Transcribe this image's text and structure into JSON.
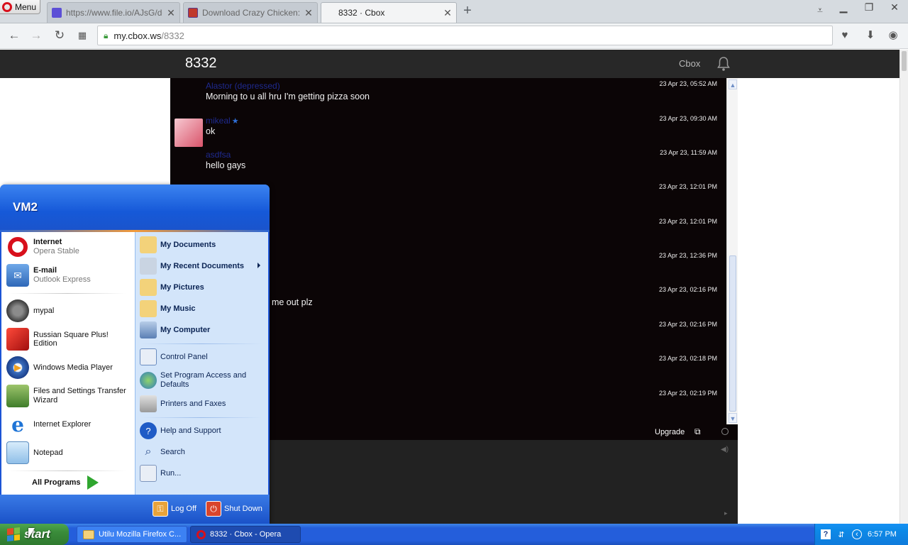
{
  "browser": {
    "menu_label": "Menu",
    "tabs": [
      {
        "title": "https://www.file.io/AJsG/do",
        "favicon_color": "#5c4fd6"
      },
      {
        "title": "Download Crazy Chicken: Th",
        "favicon_color": "#c0392b"
      },
      {
        "title": "8332 · Cbox",
        "favicon_color": "#ffffff"
      }
    ],
    "url_domain": "my.cbox.ws",
    "url_path": "/8332"
  },
  "page": {
    "title": "8332",
    "nav_label": "Cbox"
  },
  "chat": {
    "messages": [
      {
        "user": "Alastor (depressed)",
        "text": "Morning to u all hru I'm getting pizza soon",
        "time": "23 Apr 23, 05:52 AM"
      },
      {
        "user": "mikeal",
        "text": "ok",
        "time": "23 Apr 23, 09:30 AM"
      },
      {
        "user": "asdfsa",
        "text": "hello gays",
        "time": "23 Apr 23, 11:59 AM"
      },
      {
        "user": "",
        "text": "",
        "time": "23 Apr 23, 12:01 PM"
      },
      {
        "user": "",
        "text": "",
        "time": "23 Apr 23, 12:01 PM"
      },
      {
        "user": "",
        "text": "",
        "time": "23 Apr 23, 12:36 PM"
      },
      {
        "user": "",
        "text": "t me out plz",
        "time": "23 Apr 23, 02:16 PM"
      },
      {
        "user": "",
        "text": "",
        "time": "23 Apr 23, 02:16 PM"
      },
      {
        "user": "",
        "text": "",
        "time": "23 Apr 23, 02:18 PM"
      },
      {
        "user": "",
        "text": "",
        "time": "23 Apr 23, 02:19 PM"
      }
    ],
    "upgrade_label": "Upgrade"
  },
  "start_menu": {
    "user_name": "VM2",
    "pinned": [
      {
        "title": "Internet",
        "subtitle": "Opera Stable"
      },
      {
        "title": "E-mail",
        "subtitle": "Outlook Express"
      }
    ],
    "recent": [
      {
        "title": "mypal"
      },
      {
        "title": "Russian Square Plus! Edition"
      },
      {
        "title": "Windows Media Player"
      },
      {
        "title": "Files and Settings Transfer Wizard"
      },
      {
        "title": "Internet Explorer"
      },
      {
        "title": "Notepad"
      }
    ],
    "all_programs": "All Programs",
    "places": [
      {
        "title": "My Documents"
      },
      {
        "title": "My Recent Documents"
      },
      {
        "title": "My Pictures"
      },
      {
        "title": "My Music"
      },
      {
        "title": "My Computer"
      }
    ],
    "system": [
      {
        "title": "Control Panel"
      },
      {
        "title": "Set Program Access and Defaults"
      },
      {
        "title": "Printers and Faxes"
      }
    ],
    "support": [
      {
        "title": "Help and Support"
      },
      {
        "title": "Search"
      },
      {
        "title": "Run..."
      }
    ],
    "log_off": "Log Off",
    "shut_down": "Shut Down"
  },
  "taskbar": {
    "start_label": "start",
    "tasks": [
      {
        "title": "Utilu Mozilla Firefox C..."
      },
      {
        "title": "8332 · Cbox - Opera"
      }
    ],
    "clock": "6:57 PM"
  }
}
